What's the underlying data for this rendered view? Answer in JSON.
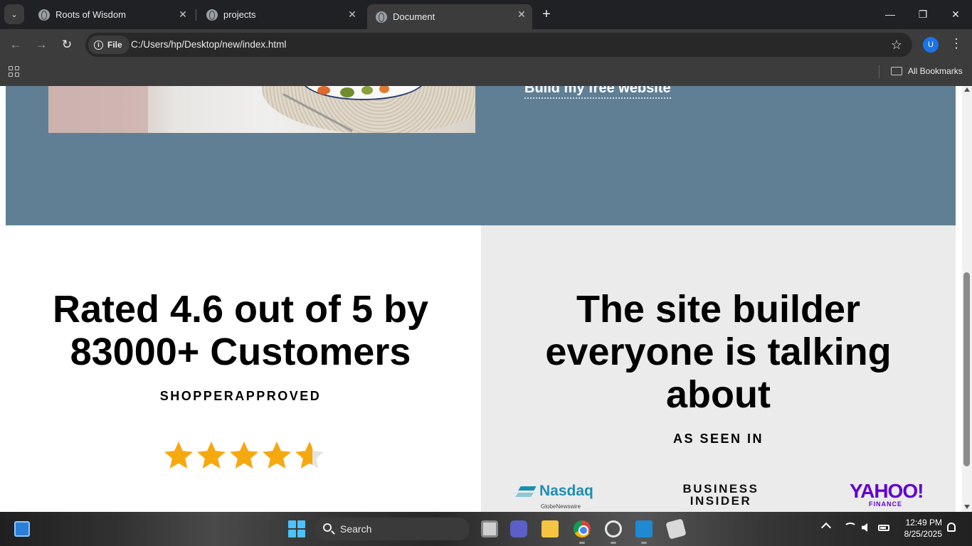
{
  "browser": {
    "tabs": [
      {
        "title": "Roots of Wisdom",
        "active": false
      },
      {
        "title": "projects",
        "active": false
      },
      {
        "title": "Document",
        "active": true
      }
    ],
    "address": {
      "scheme_chip": "File",
      "url": "C:/Users/hp/Desktop/new/index.html"
    },
    "profile_initial": "U",
    "bookmarks_label": "All Bookmarks"
  },
  "page": {
    "hero": {
      "cta_link": "Build my free website",
      "background_color": "#607f95"
    },
    "rating": {
      "heading_line1": "Rated 4.6 out of 5 by",
      "heading_line2": "83000+ Customers",
      "source": "SHOPPERAPPROVED",
      "stars_value": 4.6,
      "stars_max": 5,
      "star_color": "#f6a80f"
    },
    "media": {
      "heading_line1": "The site builder",
      "heading_line2": "everyone is talking",
      "heading_line3": "about",
      "kicker": "AS SEEN IN",
      "background_color": "#ebebeb",
      "logos": [
        {
          "name": "Nasdaq",
          "sub": "GlobeNewswire"
        },
        {
          "name": "BUSINESS INSIDER"
        },
        {
          "name": "YAHOO!",
          "sub": "FINANCE"
        }
      ]
    }
  },
  "taskbar": {
    "search_label": "Search",
    "time": "12:49 PM",
    "date": "8/25/2025"
  }
}
